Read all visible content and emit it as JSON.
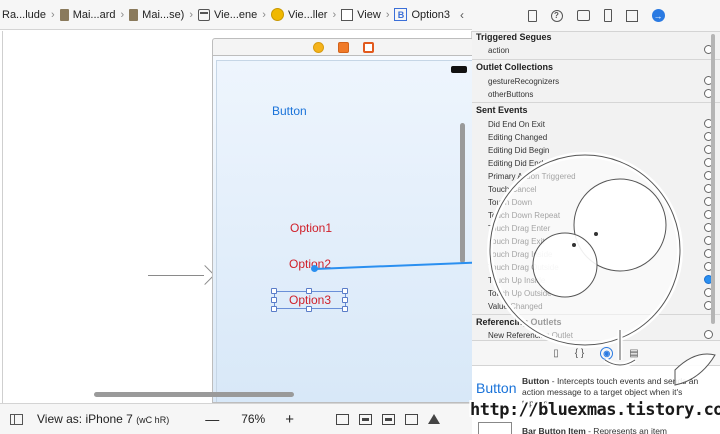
{
  "breadcrumbs": {
    "c1": "Ra...lude",
    "c2": "Mai...ard",
    "c3": "Mai...se)",
    "c4": "Vie...ene",
    "c5": "Vie...ller",
    "c6": "View",
    "c7": "Option3"
  },
  "canvas": {
    "button_label": "Button",
    "option1": "Option1",
    "option2": "Option2",
    "option3": "Option3"
  },
  "bottom_bar": {
    "view_as": "View as: iPhone 7",
    "size_class": "(wC hR)",
    "zoom_out": "—",
    "zoom_level": "76%",
    "zoom_in": "+"
  },
  "inspector": {
    "triggered_segues": {
      "title": "Triggered Segues",
      "items": [
        "action"
      ]
    },
    "outlet_collections": {
      "title": "Outlet Collections",
      "items": [
        "gestureRecognizers",
        "otherButtons"
      ]
    },
    "sent_events": {
      "title": "Sent Events",
      "items": [
        "Did End On Exit",
        "Editing Changed",
        "Editing Did Begin",
        "Editing Did End",
        "Primary Action Triggered",
        "Touch Cancel",
        "Touch Down",
        "Touch Down Repeat",
        "Touch Drag Enter",
        "Touch Drag Exit",
        "Touch Drag Inside",
        "Touch Drag Outside",
        "Touch Up Inside",
        "Touch Up Outside",
        "Value Changed"
      ]
    },
    "referencing_outlets": {
      "title": "Referencing Outlets",
      "items": [
        "New Referencing Outlet"
      ]
    }
  },
  "library": {
    "item_name": "Button",
    "item_title": "Button",
    "item_description": " - Intercepts touch events and sends an action message to a target object when it's tapped.",
    "next_item_title": "Bar Button Item",
    "next_item_description": " - Represents an item"
  },
  "watermark": {
    "url": "http://bluexmas.tistory.com/"
  },
  "colors": {
    "accent_blue": "#1a73d9",
    "option_red": "#d0202a",
    "connection_blue": "#2a8ff0"
  }
}
